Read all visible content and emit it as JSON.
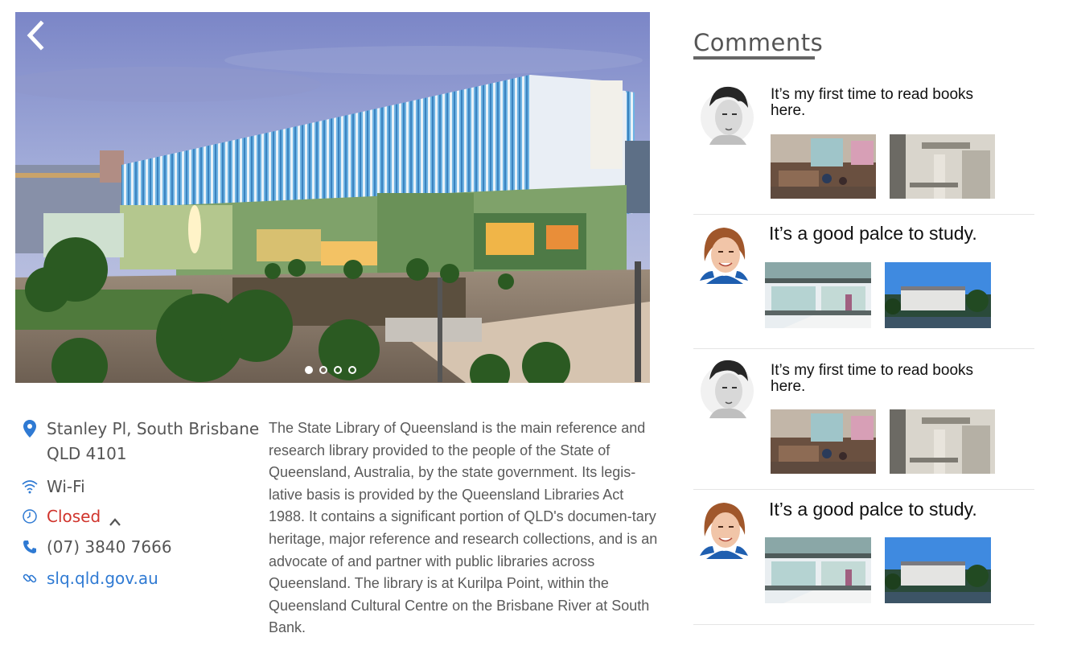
{
  "hero": {
    "slide_count": 4,
    "active_slide": 0
  },
  "info": {
    "address_line1": "Stanley Pl, South Brisbane",
    "address_line2": "QLD 4101",
    "wifi": "Wi-Fi",
    "hours_status": "Closed",
    "phone": "(07) 3840 7666",
    "website": "slq.qld.gov.au",
    "colors": {
      "closed": "#d0342c",
      "link": "#2f7ad3",
      "icon": "#2f7ad3"
    }
  },
  "description": "The State Library of Queensland is the main reference and research library provided to the people of the State of Queensland, Australia, by the state government. Its legis-lative basis is provided by the Queensland Libraries Act 1988. It contains a significant portion of QLD's documen-tary heritage, major reference and research collections, and is an advocate of and partner with public libraries across Queensland. The library is at Kurilpa Point, within the Queensland Cultural Centre on the Brisbane River at South Bank.",
  "comments": {
    "title": "Comments",
    "items": [
      {
        "text": "It’s my first time to read books here.",
        "avatar": "male-avatar"
      },
      {
        "text": "It’s a good palce to study.",
        "avatar": "female-avatar"
      },
      {
        "text": "It’s my first time to read books here.",
        "avatar": "male-avatar"
      },
      {
        "text": "It’s a good palce to study.",
        "avatar": "female-avatar"
      }
    ]
  }
}
